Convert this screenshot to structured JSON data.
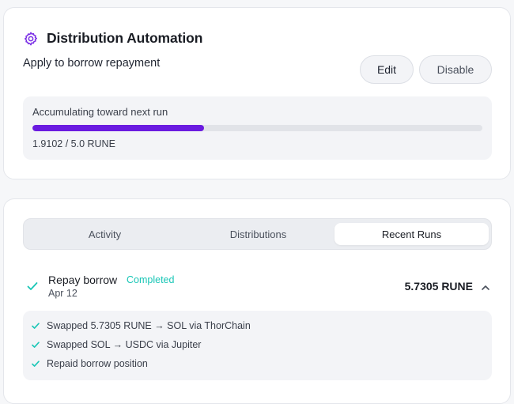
{
  "automation": {
    "title": "Distribution Automation",
    "icon": "gear-icon",
    "subtitle": "Apply to borrow repayment",
    "edit_label": "Edit",
    "disable_label": "Disable"
  },
  "progress": {
    "label": "Accumulating toward next run",
    "value_text": "1.9102 / 5.0 RUNE",
    "current": 1.9102,
    "target": 5.0,
    "fill_color": "#6a1be0"
  },
  "tabs": [
    {
      "label": "Activity",
      "selected": false
    },
    {
      "label": "Distributions",
      "selected": false
    },
    {
      "label": "Recent Runs",
      "selected": true
    }
  ],
  "run": {
    "title": "Repay borrow",
    "status": "Completed",
    "status_color": "#19c6b6",
    "date": "Apr 12",
    "amount": "5.7305 RUNE",
    "expanded": true,
    "steps": [
      {
        "text": "Swapped 5.7305 RUNE → SOL via ThorChain"
      },
      {
        "text": "Swapped SOL → USDC via Jupiter"
      },
      {
        "text": "Repaid borrow position"
      }
    ]
  }
}
